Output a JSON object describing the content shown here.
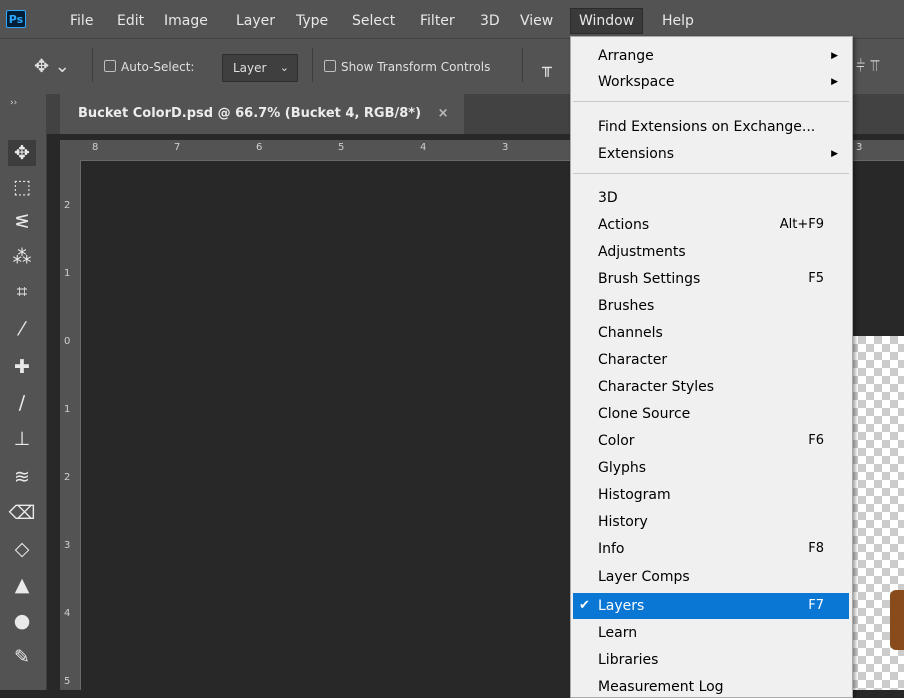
{
  "app": {
    "logo": "Ps"
  },
  "menubar": {
    "items": [
      "File",
      "Edit",
      "Image",
      "Layer",
      "Type",
      "Select",
      "Filter",
      "3D",
      "View",
      "Window",
      "Help"
    ],
    "active": "Window"
  },
  "options": {
    "auto_select": "Auto-Select:",
    "layer_dropdown": "Layer",
    "show_transform": "Show Transform Controls"
  },
  "document": {
    "tab_title": "Bucket ColorD.psd @ 66.7% (Bucket 4, RGB/8*)",
    "close": "×"
  },
  "rulers": {
    "top": [
      "8",
      "7",
      "6",
      "5",
      "4",
      "3",
      "2",
      "3"
    ],
    "left": [
      "2",
      "1",
      "0",
      "1",
      "2",
      "3",
      "4",
      "5"
    ]
  },
  "tools": [
    {
      "name": "move-tool",
      "glyph": "✥"
    },
    {
      "name": "marquee-tool",
      "glyph": "⬚"
    },
    {
      "name": "lasso-tool",
      "glyph": "ᓬ"
    },
    {
      "name": "magic-wand-tool",
      "glyph": "⁂"
    },
    {
      "name": "crop-tool",
      "glyph": "⌗"
    },
    {
      "name": "eyedropper-tool",
      "glyph": "⁄"
    },
    {
      "name": "healing-brush-tool",
      "glyph": "✚"
    },
    {
      "name": "brush-tool",
      "glyph": "∕"
    },
    {
      "name": "stamp-tool",
      "glyph": "⊥"
    },
    {
      "name": "history-brush-tool",
      "glyph": "≋"
    },
    {
      "name": "eraser-tool",
      "glyph": "⌫"
    },
    {
      "name": "paint-bucket-tool",
      "glyph": "◇"
    },
    {
      "name": "sharpen-tool",
      "glyph": "▲"
    },
    {
      "name": "dodge-tool",
      "glyph": "●"
    },
    {
      "name": "pen-tool",
      "glyph": "✎"
    }
  ],
  "window_menu": {
    "groups": [
      [
        {
          "label": "Arrange",
          "submenu": true
        },
        {
          "label": "Workspace",
          "submenu": true
        }
      ],
      [
        {
          "label": "Find Extensions on Exchange..."
        },
        {
          "label": "Extensions",
          "submenu": true
        }
      ],
      [
        {
          "label": "3D"
        },
        {
          "label": "Actions",
          "shortcut": "Alt+F9"
        },
        {
          "label": "Adjustments"
        },
        {
          "label": "Brush Settings",
          "shortcut": "F5"
        },
        {
          "label": "Brushes"
        },
        {
          "label": "Channels"
        },
        {
          "label": "Character"
        },
        {
          "label": "Character Styles"
        },
        {
          "label": "Clone Source"
        },
        {
          "label": "Color",
          "shortcut": "F6"
        },
        {
          "label": "Glyphs"
        },
        {
          "label": "Histogram"
        },
        {
          "label": "History"
        },
        {
          "label": "Info",
          "shortcut": "F8"
        },
        {
          "label": "Layer Comps"
        },
        {
          "label": "Layers",
          "shortcut": "F7",
          "checked": true,
          "highlighted": true
        },
        {
          "label": "Learn"
        },
        {
          "label": "Libraries"
        },
        {
          "label": "Measurement Log"
        }
      ]
    ],
    "check_glyph": "✔",
    "submenu_glyph": "▶"
  },
  "colors": {
    "highlight": "#0a77d5",
    "menubar": "#535353",
    "canvas": "#282828"
  }
}
